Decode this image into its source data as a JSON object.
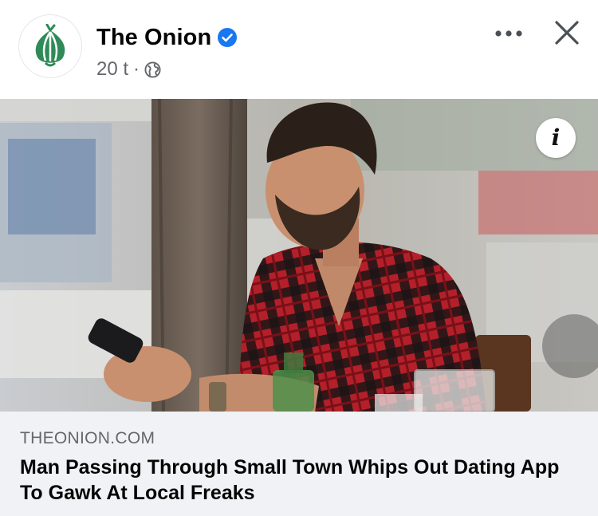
{
  "post": {
    "page_name": "The Onion",
    "time": "20 t",
    "separator": "·",
    "verified_icon": "verified-badge-icon",
    "audience_icon": "globe-icon",
    "more_icon": "more-horizontal-icon",
    "close_icon": "close-icon",
    "avatar_icon": "onion-logo-icon"
  },
  "photo": {
    "info_label": "i"
  },
  "link": {
    "domain": "THEONION.COM",
    "title": "Man Passing Through Small Town Whips Out Dating App To Gawk At Local Freaks"
  },
  "colors": {
    "brand_green": "#2e8b57",
    "verified_blue": "#1877f2",
    "secondary_text": "#65676b",
    "preview_bg": "#f0f2f5"
  }
}
